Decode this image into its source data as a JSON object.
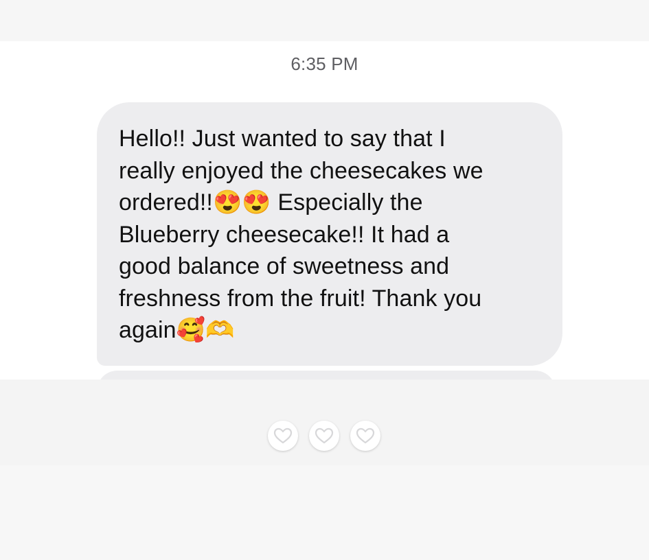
{
  "conversation": {
    "timestamp": "6:35 PM",
    "message": {
      "text": "Hello!! Just wanted to say that I\nreally enjoyed the cheesecakes we\nordered!!😍😍 Especially the\nBlueberry cheesecake!! It had a\ngood balance of sweetness and\nfreshness from the fruit! Thank you\nagain🥰🫶"
    }
  },
  "reactions": [
    {
      "icon": "heart-outline-icon"
    },
    {
      "icon": "heart-outline-icon"
    },
    {
      "icon": "heart-outline-icon"
    }
  ],
  "colors": {
    "bubble": "#ededef",
    "timestamp": "#5e5e62",
    "text": "#111111",
    "background": "#ffffff",
    "panel": "#f4f4f4"
  }
}
